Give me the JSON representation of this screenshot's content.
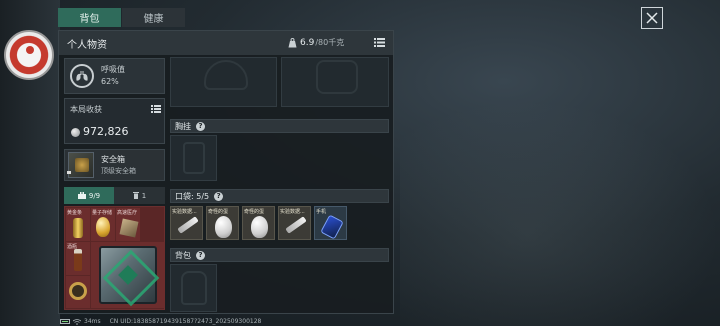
{
  "tabs": [
    {
      "label": "背包",
      "active": true
    },
    {
      "label": "健康",
      "active": false
    }
  ],
  "panel": {
    "title": "个人物资",
    "weight_current": "6.9",
    "weight_max": "/80千克"
  },
  "respiration": {
    "label": "呼吸值",
    "value": "62%"
  },
  "earnings": {
    "label": "本局收获",
    "value": "972,826"
  },
  "safe_box": {
    "title": "安全箱",
    "subtitle": "顶级安全箱"
  },
  "inventory_tabs": [
    {
      "label": "9/9",
      "icon": "briefcase-icon"
    },
    {
      "label": "1",
      "icon": "trash-icon"
    }
  ],
  "safe_items": [
    {
      "label": "黄金条",
      "icon": "gold-bar"
    },
    {
      "label": "量子存储",
      "icon": "golden-egg"
    },
    {
      "label": "高速医疗",
      "icon": "med-pack"
    },
    {
      "label": "酒瓶",
      "icon": "bottle"
    },
    {
      "label": "",
      "icon": "supply-box"
    },
    {
      "label": "",
      "icon": "gold-watch"
    }
  ],
  "sections": {
    "chest": "胸挂",
    "pocket": "口袋: 5/5",
    "backpack": "背包"
  },
  "pocket_items": [
    {
      "label": "实验数据...",
      "icon": "syringe"
    },
    {
      "label": "奇怪的蛋",
      "icon": "white-egg"
    },
    {
      "label": "奇怪的蛋",
      "icon": "white-egg"
    },
    {
      "label": "实验数据...",
      "icon": "syringe"
    },
    {
      "label": "手机",
      "icon": "phone"
    }
  ],
  "status": {
    "ping": "34ms",
    "cn_uid": "CN UID:1838587194391587?2473_202509300128"
  },
  "colors": {
    "accent_green": "#2f6b5b",
    "safe_red": "#5a2626",
    "pocket_gold": "#3c3b36"
  }
}
